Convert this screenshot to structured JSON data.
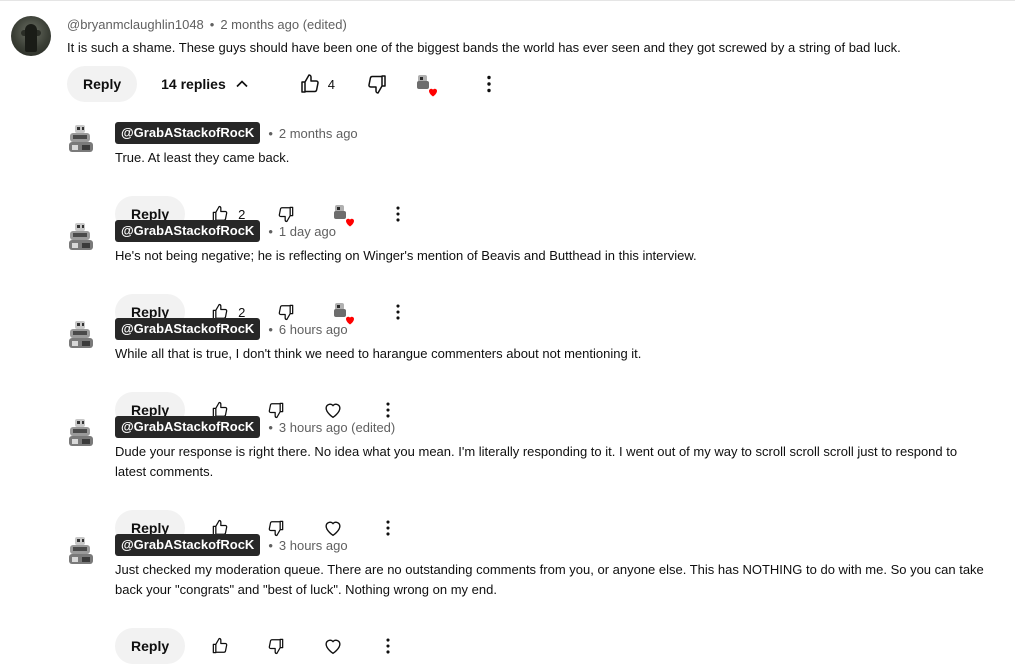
{
  "top_comment": {
    "author": "@bryanmclaughlin1048",
    "time": "2 months ago (edited)",
    "text": "It is such a shame. These guys should have been one of the biggest bands the world has ever seen and they got screwed by a string of bad luck.",
    "reply_label": "Reply",
    "replies_label": "14 replies",
    "likes": "4"
  },
  "replies": [
    {
      "author": "@GrabAStackofRocK",
      "time": "2 months ago",
      "text": "True.  At least they came back.",
      "likes": "2",
      "hearted": true
    },
    {
      "author": "@GrabAStackofRocK",
      "time": "1 day ago",
      "text": "He's not being negative; he is reflecting on Winger's mention of Beavis and Butthead in this interview.",
      "likes": "2",
      "hearted": true
    },
    {
      "author": "@GrabAStackofRocK",
      "time": "6 hours ago",
      "text": "While all that is true, I don't think we need to harangue commenters about not mentioning it.",
      "likes": "",
      "hearted": false
    },
    {
      "author": "@GrabAStackofRocK",
      "time": "3 hours ago (edited)",
      "text": "Dude your response is right there.  No idea what you mean.  I'm literally responding to it.  I went out of my way to scroll scroll scroll just to respond to latest comments.",
      "likes": "",
      "hearted": false
    },
    {
      "author": "@GrabAStackofRocK",
      "time": "3 hours ago",
      "text": "Just checked my moderation queue.  There are no outstanding comments from you, or anyone else.  This has NOTHING to do with me.  So you can take back your \"congrats\" and \"best of luck\".  Nothing wrong on my end.",
      "likes": "",
      "hearted": false
    }
  ],
  "reply_label": "Reply",
  "separator": "•",
  "icons": {
    "like": "thumb-up-icon",
    "dislike": "thumb-down-icon",
    "heart": "heart-outline-icon",
    "more": "more-vert-icon",
    "chevron": "chevron-up-icon",
    "creator_heart": "creator-heart-icon"
  },
  "colors": {
    "heart_red": "#ff0000",
    "badge_bg": "#272727",
    "button_bg": "#f2f2f2",
    "meta_gray": "#606060"
  }
}
